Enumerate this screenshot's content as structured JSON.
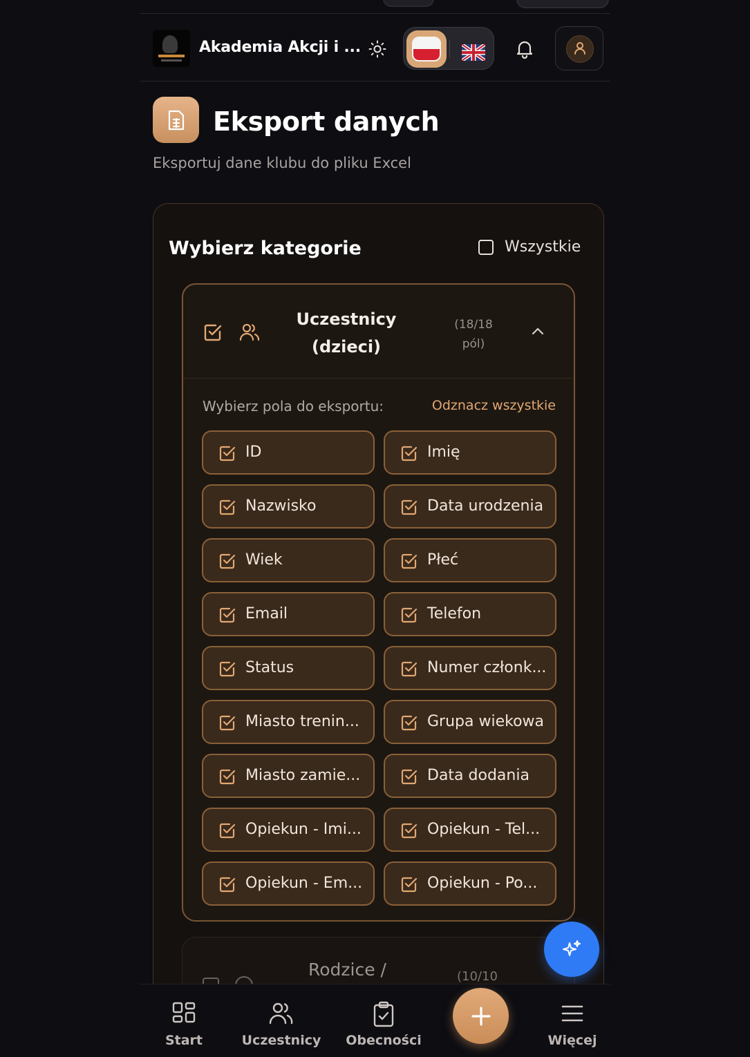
{
  "header": {
    "app_title": "Akademia Akcji i ...",
    "lang_active": "pl",
    "lang_other": "en"
  },
  "page": {
    "title": "Eksport danych",
    "subtitle": "Eksportuj dane klubu do pliku Excel"
  },
  "card": {
    "title": "Wybierz kategorie",
    "select_all_label": "Wszystkie",
    "select_all_checked": false,
    "category": {
      "name_line1": "Uczestnicy",
      "name_line2": "(dzieci)",
      "count_line1": "(18/18",
      "count_line2": "pól)",
      "checked": true,
      "expanded": true,
      "fields_label": "Wybierz pola do eksportu:",
      "uncheck_all_label": "Odznacz wszystkie",
      "fields": [
        "ID",
        "Imię",
        "Nazwisko",
        "Data urodzenia",
        "Wiek",
        "Płeć",
        "Email",
        "Telefon",
        "Status",
        "Numer członk...",
        "Miasto trenin...",
        "Grupa wiekowa",
        "Miasto zamie...",
        "Data dodania",
        "Opiekun - Imi...",
        "Opiekun - Tel...",
        "Opiekun - Em...",
        "Opiekun - Po..."
      ]
    },
    "category2": {
      "name": "Rodzice /",
      "count": "(10/10"
    }
  },
  "bottom_nav": {
    "start": "Start",
    "participants": "Uczestnicy",
    "attendance": "Obecności",
    "more": "Więcej"
  },
  "colors": {
    "accent": "#d9a777",
    "background": "#0d0d12",
    "ai_fab": "#2f7bf5"
  }
}
